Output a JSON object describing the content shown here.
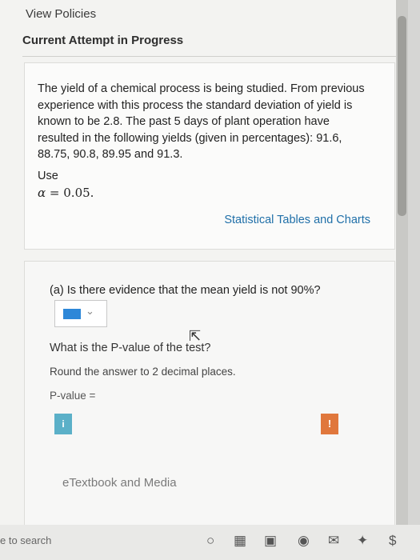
{
  "header": {
    "view_policies": "View Policies",
    "attempt_status": "Current Attempt in Progress"
  },
  "question": {
    "text": "The yield of a chemical process is being studied. From previous experience with this process the standard deviation of yield is known to be 2.8. The past 5 days of plant operation have resulted in the following yields (given in percentages): 91.6, 88.75, 90.8, 89.95 and 91.3.",
    "use_label": "Use",
    "alpha_symbol": "α",
    "alpha_value": "= 0.05.",
    "tables_link": "Statistical Tables and Charts"
  },
  "part_a": {
    "prompt": "(a) Is there evidence that the mean yield is not 90%?",
    "pvalue_question": "What is the P-value of the test?",
    "round_instruction": "Round the answer to 2 decimal places.",
    "pvalue_label": "P-value =",
    "info_icon_glyph": "i",
    "warn_icon_glyph": "!",
    "etextbook": "eTextbook and Media"
  },
  "taskbar": {
    "search_text": "e to search"
  },
  "colors": {
    "accent_link": "#1f6fa8",
    "dropdown_fill": "#2d87d8",
    "info_icon": "#5bb0c8",
    "warn_icon": "#e0773c"
  }
}
